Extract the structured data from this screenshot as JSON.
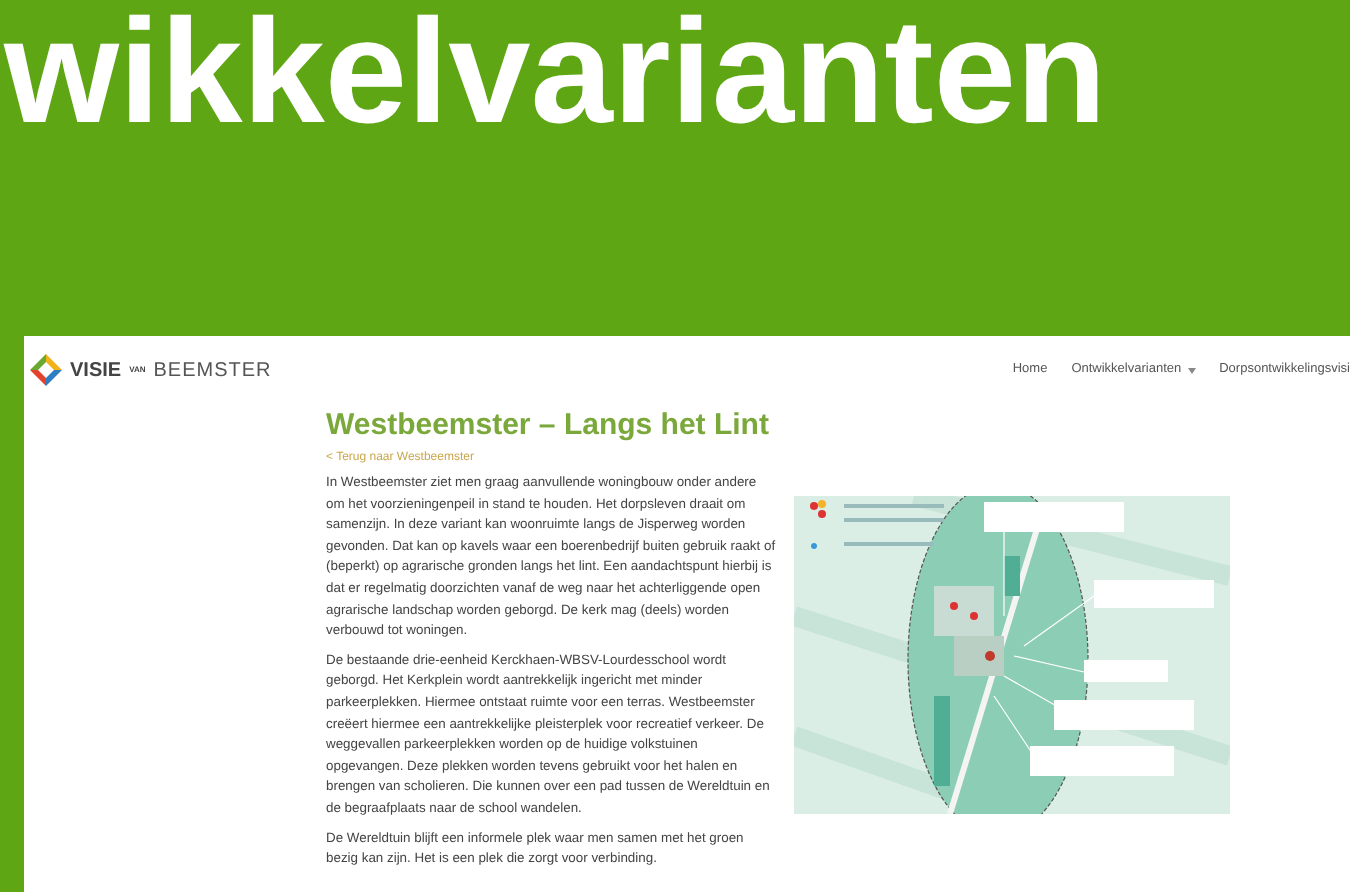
{
  "slide": {
    "title": "wikkelvarianten"
  },
  "site": {
    "logo": {
      "brand": "VISIE",
      "small": "VAN",
      "name": "BEEMSTER"
    },
    "nav": [
      {
        "label": "Home",
        "dropdown": false
      },
      {
        "label": "Ontwikkelvarianten",
        "dropdown": true
      },
      {
        "label": "Dorpsontwikkelingsvisi",
        "dropdown": false
      }
    ],
    "heading": "Westbeemster – Langs het Lint",
    "back_link": "< Terug naar Westbeemster",
    "paragraphs": [
      "In Westbeemster ziet men graag aanvullende woningbouw onder andere om het voorzieningenpeil in stand te houden. Het dorpsleven draait om samenzijn. In deze variant kan woonruimte langs de Jisperweg worden gevonden. Dat kan op kavels waar een boerenbedrijf buiten gebruik raakt of (beperkt) op agrarische gronden langs het lint. Een aandachtspunt hierbij is dat er regelmatig doorzichten vanaf de weg naar het achterliggende open agrarische landschap worden geborgd. De kerk mag (deels) worden verbouwd tot woningen.",
      "De bestaande drie-eenheid Kerckhaen-WBSV-Lourdesschool wordt geborgd. Het Kerkplein wordt aantrekkelijk ingericht met minder parkeerplekken. Hiermee ontstaat ruimte voor een terras. Westbeemster creëert hiermee een aantrekkelijke pleisterplek voor recreatief verkeer. De weggevallen parkeerplekken worden op de huidige volkstuinen opgevangen. Deze plekken worden tevens gebruikt voor het halen en brengen van scholieren. Die kunnen over een pad tussen de Wereldtuin en de begraafplaats naar de school wandelen.",
      "De Wereldtuin blijft een informele plek waar men samen met het groen bezig kan zijn. Het is een plek die zorgt voor verbinding."
    ]
  }
}
